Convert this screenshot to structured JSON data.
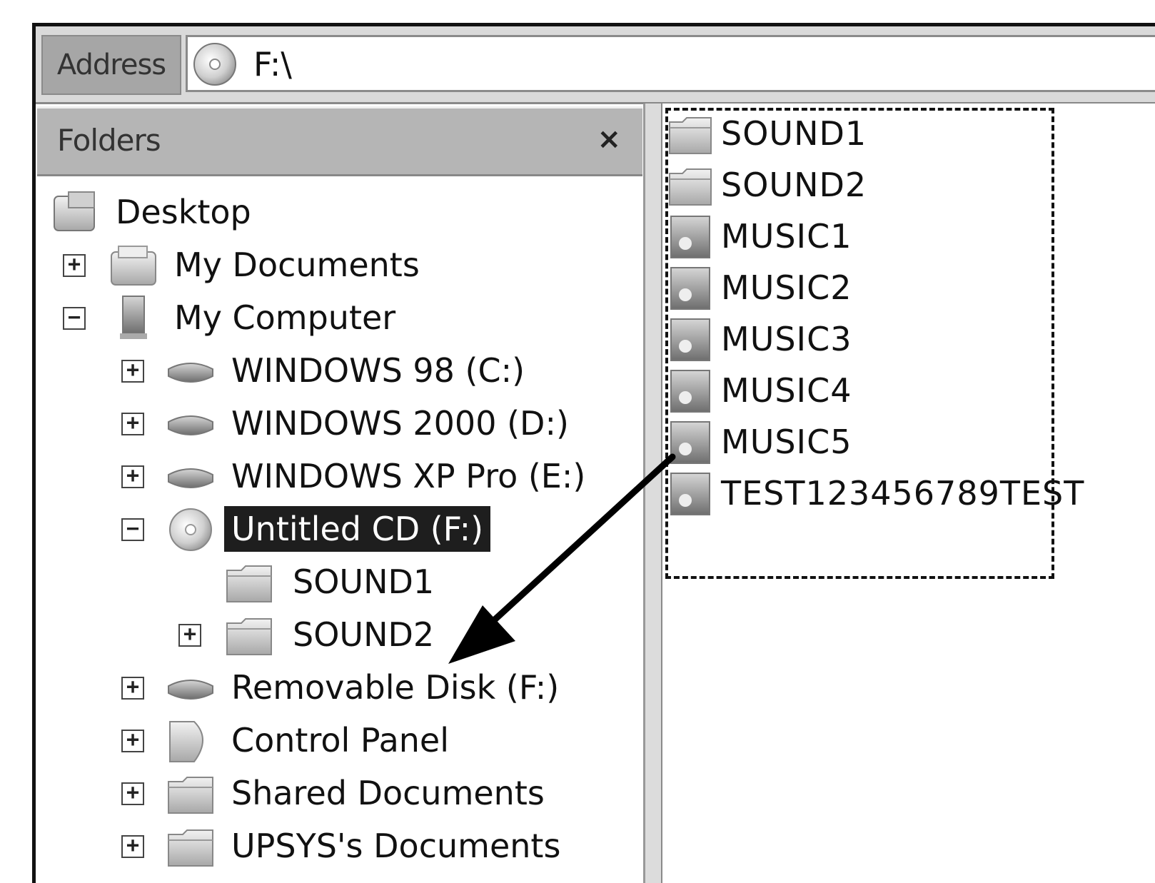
{
  "address_bar": {
    "label": "Address",
    "value": "F:\\",
    "icon": "cd-drive-icon"
  },
  "folders_pane": {
    "title": "Folders",
    "close_glyph": "×",
    "tree": [
      {
        "id": "desktop",
        "label": "Desktop",
        "icon": "desktop-icon",
        "expander": ""
      },
      {
        "id": "my-documents",
        "label": "My Documents",
        "icon": "my-documents-icon",
        "expander": "+"
      },
      {
        "id": "my-computer",
        "label": "My Computer",
        "icon": "my-computer-icon",
        "expander": "−"
      },
      {
        "id": "drive-c",
        "label": "WINDOWS 98 (C:)",
        "icon": "hard-drive-icon",
        "expander": "+"
      },
      {
        "id": "drive-d",
        "label": "WINDOWS 2000 (D:)",
        "icon": "hard-drive-icon",
        "expander": "+"
      },
      {
        "id": "drive-e",
        "label": "WINDOWS XP Pro (E:)",
        "icon": "hard-drive-icon",
        "expander": "+"
      },
      {
        "id": "drive-f-cd",
        "label": "Untitled CD (F:)",
        "icon": "cd-drive-icon",
        "expander": "−",
        "selected": true
      },
      {
        "id": "sound1",
        "label": "SOUND1",
        "icon": "folder-icon",
        "expander": ""
      },
      {
        "id": "sound2",
        "label": "SOUND2",
        "icon": "folder-icon",
        "expander": "+"
      },
      {
        "id": "removable-disk",
        "label": "Removable Disk (F:)",
        "icon": "removable-disk-icon",
        "expander": "+"
      },
      {
        "id": "control-panel",
        "label": "Control Panel",
        "icon": "control-panel-icon",
        "expander": "+"
      },
      {
        "id": "shared-documents",
        "label": "Shared Documents",
        "icon": "folder-icon",
        "expander": "+"
      },
      {
        "id": "upsys-documents",
        "label": "UPSYS's Documents",
        "icon": "folder-icon",
        "expander": "+"
      }
    ]
  },
  "files_pane": {
    "items": [
      {
        "label": "SOUND1",
        "icon": "folder-icon"
      },
      {
        "label": "SOUND2",
        "icon": "folder-icon"
      },
      {
        "label": "MUSIC1",
        "icon": "audio-file-icon"
      },
      {
        "label": "MUSIC2",
        "icon": "audio-file-icon"
      },
      {
        "label": "MUSIC3",
        "icon": "audio-file-icon"
      },
      {
        "label": "MUSIC4",
        "icon": "audio-file-icon"
      },
      {
        "label": "MUSIC5",
        "icon": "audio-file-icon"
      },
      {
        "label": "TEST123456789TEST",
        "icon": "audio-file-icon"
      }
    ]
  },
  "colors": {
    "selection_bg": "#1e1e1e",
    "header_bg": "#b5b5b5",
    "address_label_bg": "#a6a6a6"
  }
}
